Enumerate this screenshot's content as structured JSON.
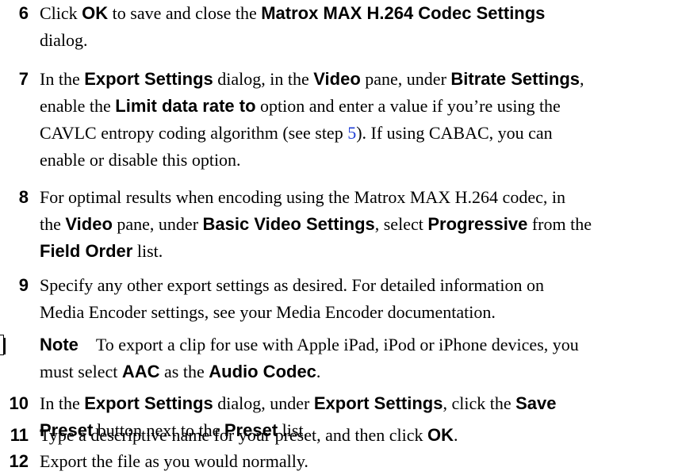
{
  "steps": {
    "s6": {
      "num": "6",
      "t1": "Click ",
      "b1": "OK",
      "t2": " to save and close the ",
      "b2": "Matrox MAX H.264 Codec Settings",
      "t3": "dialog."
    },
    "s7": {
      "num": "7",
      "t1": "In the ",
      "b1": "Export Settings",
      "t2": " dialog, in the ",
      "b2": "Video",
      "t3": " pane, under ",
      "b3": "Bitrate Settings",
      "t4": ",",
      "t5": "enable the ",
      "b4": "Limit data rate to",
      "t6": " option and enter a value if you’re using the",
      "t7": "CAVLC entropy coding algorithm (see step ",
      "link": "5",
      "t8": "). If using CABAC, you can",
      "t9": "enable or disable this option."
    },
    "s8": {
      "num": "8",
      "t1": "For optimal results when encoding using the Matrox MAX H.264 codec, in",
      "t2": "the ",
      "b1": "Video",
      "t3": " pane, under ",
      "b2": "Basic Video Settings",
      "t4": ", select ",
      "b3": "Progressive",
      "t5": " from the",
      "b4": "Field Order",
      "t6": " list."
    },
    "s9": {
      "num": "9",
      "t1": "Specify any other export settings as desired. For detailed information on",
      "t2": "Media Encoder settings, see your Media Encoder documentation."
    },
    "note": {
      "label": "Note",
      "t1": "To export a clip for use with Apple iPad, iPod or iPhone devices, you",
      "t2": "must select ",
      "b1": "AAC",
      "t3": " as the ",
      "b2": "Audio Codec",
      "t4": "."
    },
    "s10": {
      "num": "10",
      "t1": "In the ",
      "b1": "Export Settings",
      "t2": " dialog, under ",
      "b2": "Export Settings",
      "t3": ", click the ",
      "b3": "Save",
      "b4": "Preset",
      "t4": " button next to the ",
      "b5": "Preset",
      "t5": " list."
    },
    "s11": {
      "num": "11",
      "t1": "Type a descriptive name for your preset, and then click ",
      "b1": "OK",
      "t2": "."
    },
    "s12": {
      "num": "12",
      "t1": "Export the file as you would normally."
    }
  },
  "colors": {
    "link": "#1f3ed6"
  },
  "icons": {
    "note": "note-icon"
  }
}
